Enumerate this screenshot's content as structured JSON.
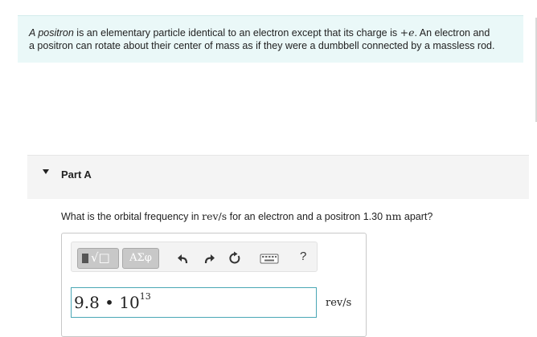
{
  "problem": {
    "line1_em": "A positron",
    "line1_rest": " is an elementary particle identical to an electron except that its charge is ",
    "charge": "+e",
    "line1_tail": ". An electron and",
    "line2": "a positron can rotate about their center of mass as if they were a dumbbell connected by a massless rod."
  },
  "part": {
    "title": "Part A"
  },
  "question": {
    "prefix": "What is the orbital frequency in ",
    "unit": "rev/s",
    "middle": " for an electron and a positron 1.30 ",
    "dist_unit": "nm",
    "suffix": " apart?"
  },
  "toolbar": {
    "template_label": "√□",
    "greek_label": "ΑΣφ",
    "help_label": "?"
  },
  "answer": {
    "mantissa": "9.8",
    "dot": " • ",
    "base": "10",
    "exponent": "13",
    "unit": "rev/s"
  }
}
